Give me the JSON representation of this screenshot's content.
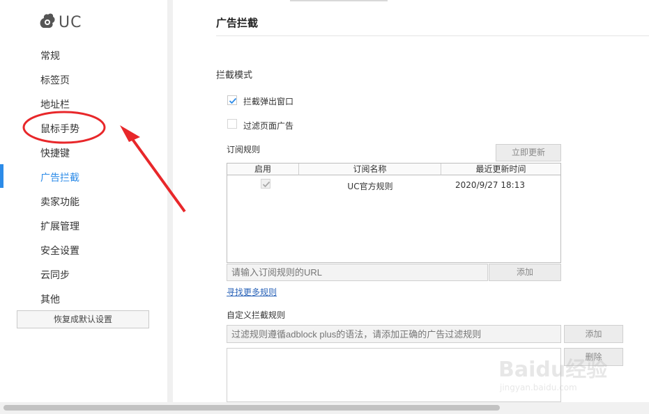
{
  "brand": {
    "name": "UC"
  },
  "sidebar": {
    "items": [
      {
        "label": "常规"
      },
      {
        "label": "标签页"
      },
      {
        "label": "地址栏"
      },
      {
        "label": "鼠标手势"
      },
      {
        "label": "快捷键"
      },
      {
        "label": "广告拦截"
      },
      {
        "label": "卖家功能"
      },
      {
        "label": "扩展管理"
      },
      {
        "label": "安全设置"
      },
      {
        "label": "云同步"
      },
      {
        "label": "其他"
      }
    ],
    "active_index": 5,
    "restore_label": "恢复成默认设置"
  },
  "main": {
    "title": "广告拦截",
    "mode_label": "拦截模式",
    "options": [
      {
        "label": "拦截弹出窗口",
        "checked": true
      },
      {
        "label": "过滤页面广告",
        "checked": false
      }
    ],
    "subscription": {
      "label": "订阅规则",
      "update_button": "立即更新",
      "columns": [
        "启用",
        "订阅名称",
        "最近更新时间"
      ],
      "rows": [
        {
          "enabled": true,
          "name": "UC官方规则",
          "updated": "2020/9/27 18:13"
        }
      ],
      "url_placeholder": "请输入订阅规则的URL",
      "add_button": "添加",
      "find_more_link": "寻找更多规则"
    },
    "custom": {
      "label": "自定义拦截规则",
      "placeholder": "过滤规则遵循adblock plus的语法，请添加正确的广告过滤规则",
      "add_button": "添加",
      "delete_button": "删除"
    }
  },
  "annotation": {
    "color": "#e8272a"
  },
  "watermark": {
    "text": "Baidu经验",
    "subtext": "jingyan.baidu.com"
  }
}
